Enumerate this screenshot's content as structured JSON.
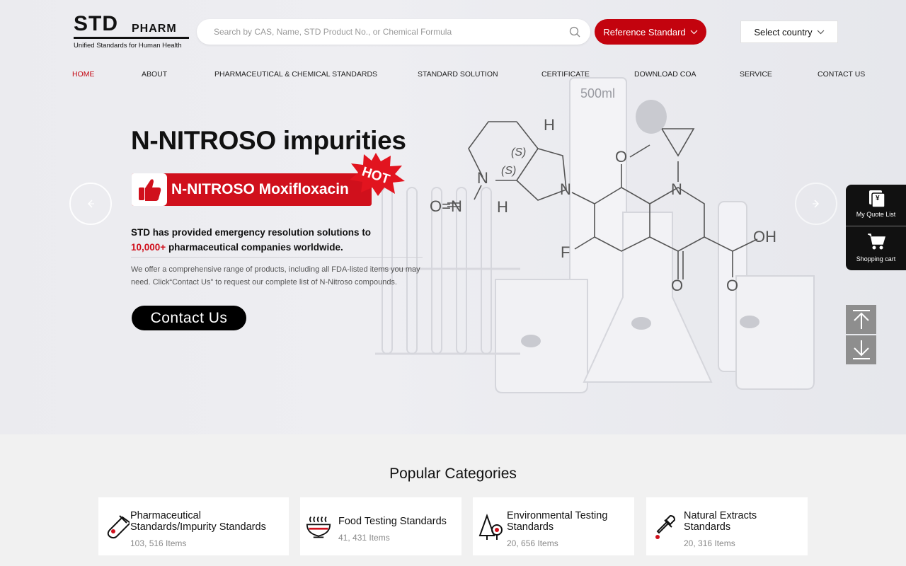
{
  "header": {
    "logo_main": "STD",
    "logo_sub": "PHARM",
    "logo_tagline": "Unified Standards for Human Health",
    "search_placeholder": "Search by CAS, Name, STD Product No., or Chemical Formula",
    "reference_button": "Reference Standard",
    "country_select": "Select country"
  },
  "nav": {
    "items": [
      "HOME",
      "ABOUT",
      "PHARMACEUTICAL & CHEMICAL STANDARDS",
      "STANDARD SOLUTION",
      "CERTIFICATE",
      "DOWNLOAD COA",
      "SERVICE",
      "CONTACT US"
    ],
    "active": "HOME"
  },
  "hero": {
    "title": "N-NITROSO impurities",
    "badge": "N-NITROSO Moxifloxacin",
    "hot": "HOT",
    "lead_1": "STD has provided emergency resolution solutions to",
    "lead_red": "10,000+",
    "lead_2": " pharmaceutical companies worldwide.",
    "desc": "We offer a comprehensive range of products, including all FDA-listed items you may need. Click“Contact Us” to request our complete list of N-Nitroso compounds.",
    "cta": "Contact Us",
    "molecule_labels": {
      "H1": "H",
      "S1": "(S)",
      "S2": "(S)",
      "N1": "N",
      "N2": "N",
      "ON": "O=N",
      "H2": "H",
      "O1": "O",
      "N3": "N",
      "F": "F",
      "OH": "OH",
      "O2": "O",
      "O3": "O",
      "ml": "500ml"
    }
  },
  "side": {
    "quote": "My Quote List",
    "cart": "Shopping cart"
  },
  "categories": {
    "title": "Popular Categories",
    "items": [
      {
        "name_1": "Pharmaceutical",
        "name_2": "Standards/Impurity Standards",
        "count": "103, 516 Items"
      },
      {
        "name_1": "Food Testing Standards",
        "name_2": "",
        "count": "41, 431 Items"
      },
      {
        "name_1": "Environmental Testing",
        "name_2": "Standards",
        "count": "20, 656 Items"
      },
      {
        "name_1": "Natural Extracts",
        "name_2": "Standards",
        "count": "20, 316 Items"
      }
    ]
  },
  "colors": {
    "brand_red": "#c3030e",
    "badge_red": "#d0101c",
    "dark": "#111111"
  }
}
